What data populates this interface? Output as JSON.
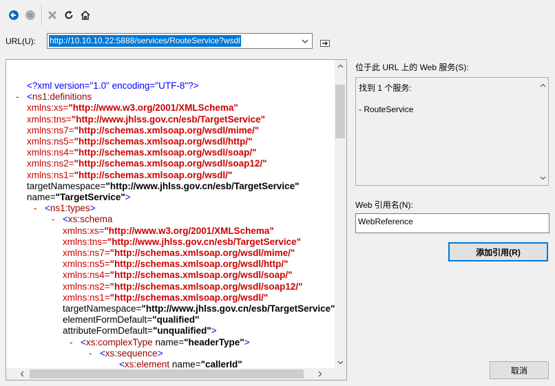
{
  "toolbar": {
    "back_icon": "back-arrow-icon",
    "stop_icon": "stop-icon",
    "close_icon": "close-x-icon",
    "refresh_icon": "refresh-icon",
    "home_icon": "home-icon"
  },
  "url": {
    "label": "URL(U):",
    "value": "http://10.10.10.22:5888/services/RouteService?wsdl"
  },
  "xml_lines": [
    {
      "minus": "",
      "parts": [
        [
          "pi",
          "<?xml version=\"1.0\" encoding=\"UTF-8\"?>"
        ]
      ]
    },
    {
      "minus": "-",
      "parts": [
        [
          "bracket",
          "<"
        ],
        [
          "tag",
          "ns1:definitions"
        ]
      ]
    },
    {
      "minus": "",
      "parts": [
        [
          "ns-attr",
          "xmlns:xs="
        ],
        [
          "ns-val",
          "\"http://www.w3.org/2001/XMLSchema\""
        ]
      ]
    },
    {
      "minus": "",
      "parts": [
        [
          "ns-attr",
          "xmlns:tns="
        ],
        [
          "ns-val",
          "\"http://www.jhlss.gov.cn/esb/TargetService\""
        ]
      ]
    },
    {
      "minus": "",
      "parts": [
        [
          "ns-attr",
          "xmlns:ns7="
        ],
        [
          "ns-val",
          "\"http://schemas.xmlsoap.org/wsdl/mime/\""
        ]
      ]
    },
    {
      "minus": "",
      "parts": [
        [
          "ns-attr",
          "xmlns:ns5="
        ],
        [
          "ns-val",
          "\"http://schemas.xmlsoap.org/wsdl/http/\""
        ]
      ]
    },
    {
      "minus": "",
      "parts": [
        [
          "ns-attr",
          "xmlns:ns4="
        ],
        [
          "ns-val",
          "\"http://schemas.xmlsoap.org/wsdl/soap/\""
        ]
      ]
    },
    {
      "minus": "",
      "parts": [
        [
          "ns-attr",
          "xmlns:ns2="
        ],
        [
          "ns-val",
          "\"http://schemas.xmlsoap.org/wsdl/soap12/\""
        ]
      ]
    },
    {
      "minus": "",
      "parts": [
        [
          "ns-attr",
          "xmlns:ns1="
        ],
        [
          "ns-val",
          "\"http://schemas.xmlsoap.org/wsdl/\""
        ]
      ]
    },
    {
      "minus": "",
      "parts": [
        [
          "plain",
          "targetNamespace="
        ],
        [
          "val",
          "\"http://www.jhlss.gov.cn/esb/TargetService\""
        ]
      ]
    },
    {
      "minus": "",
      "parts": [
        [
          "plain",
          "name="
        ],
        [
          "val",
          "\"TargetService\""
        ],
        [
          "bracket",
          ">"
        ]
      ]
    },
    {
      "minus": "-",
      "parts": [
        [
          "bracket",
          "<"
        ],
        [
          "tag",
          "ns1:types"
        ],
        [
          "bracket",
          ">"
        ]
      ]
    },
    {
      "minus": "-",
      "parts": [
        [
          "bracket",
          "<"
        ],
        [
          "tag",
          "xs:schema"
        ]
      ]
    },
    {
      "minus": "",
      "parts": [
        [
          "ns-attr",
          "xmlns:xs="
        ],
        [
          "ns-val",
          "\"http://www.w3.org/2001/XMLSchema\""
        ]
      ]
    },
    {
      "minus": "",
      "parts": [
        [
          "ns-attr",
          "xmlns:tns="
        ],
        [
          "ns-val",
          "\"http://www.jhlss.gov.cn/esb/TargetService\""
        ]
      ]
    },
    {
      "minus": "",
      "parts": [
        [
          "ns-attr",
          "xmlns:ns7="
        ],
        [
          "ns-val",
          "\"http://schemas.xmlsoap.org/wsdl/mime/\""
        ]
      ]
    },
    {
      "minus": "",
      "parts": [
        [
          "ns-attr",
          "xmlns:ns5="
        ],
        [
          "ns-val",
          "\"http://schemas.xmlsoap.org/wsdl/http/\""
        ]
      ]
    },
    {
      "minus": "",
      "parts": [
        [
          "ns-attr",
          "xmlns:ns4="
        ],
        [
          "ns-val",
          "\"http://schemas.xmlsoap.org/wsdl/soap/\""
        ]
      ]
    },
    {
      "minus": "",
      "parts": [
        [
          "ns-attr",
          "xmlns:ns2="
        ],
        [
          "ns-val",
          "\"http://schemas.xmlsoap.org/wsdl/soap12/\""
        ]
      ]
    },
    {
      "minus": "",
      "parts": [
        [
          "ns-attr",
          "xmlns:ns1="
        ],
        [
          "ns-val",
          "\"http://schemas.xmlsoap.org/wsdl/\""
        ]
      ]
    },
    {
      "minus": "",
      "parts": [
        [
          "plain",
          "targetNamespace="
        ],
        [
          "val",
          "\"http://www.jhlss.gov.cn/esb/TargetService\""
        ]
      ]
    },
    {
      "minus": "",
      "parts": [
        [
          "plain",
          "elementFormDefault="
        ],
        [
          "val",
          "\"qualified\""
        ]
      ]
    },
    {
      "minus": "",
      "parts": [
        [
          "plain",
          "attributeFormDefault="
        ],
        [
          "val",
          "\"unqualified\""
        ],
        [
          "bracket",
          ">"
        ]
      ]
    },
    {
      "minus": "-",
      "parts": [
        [
          "bracket",
          "<"
        ],
        [
          "tag",
          "xs:complexType"
        ],
        [
          "plain",
          " name="
        ],
        [
          "val",
          "\"headerType\""
        ],
        [
          "bracket",
          ">"
        ]
      ]
    },
    {
      "minus": "-",
      "parts": [
        [
          "bracket",
          "<"
        ],
        [
          "tag",
          "xs:sequence"
        ],
        [
          "bracket",
          ">"
        ]
      ]
    },
    {
      "minus": "",
      "parts": [
        [
          "bracket",
          "<"
        ],
        [
          "tag",
          "xs:element"
        ],
        [
          "plain",
          " name="
        ],
        [
          "val",
          "\"callerId\""
        ]
      ]
    }
  ],
  "services": {
    "label": "位于此 URL 上的 Web 服务(S):",
    "found": "找到 1 个服务:",
    "items": [
      "- RouteService"
    ]
  },
  "reference": {
    "label": "Web 引用名(N):",
    "value": "WebReference"
  },
  "buttons": {
    "add": "添加引用(R)",
    "cancel": "取消"
  }
}
